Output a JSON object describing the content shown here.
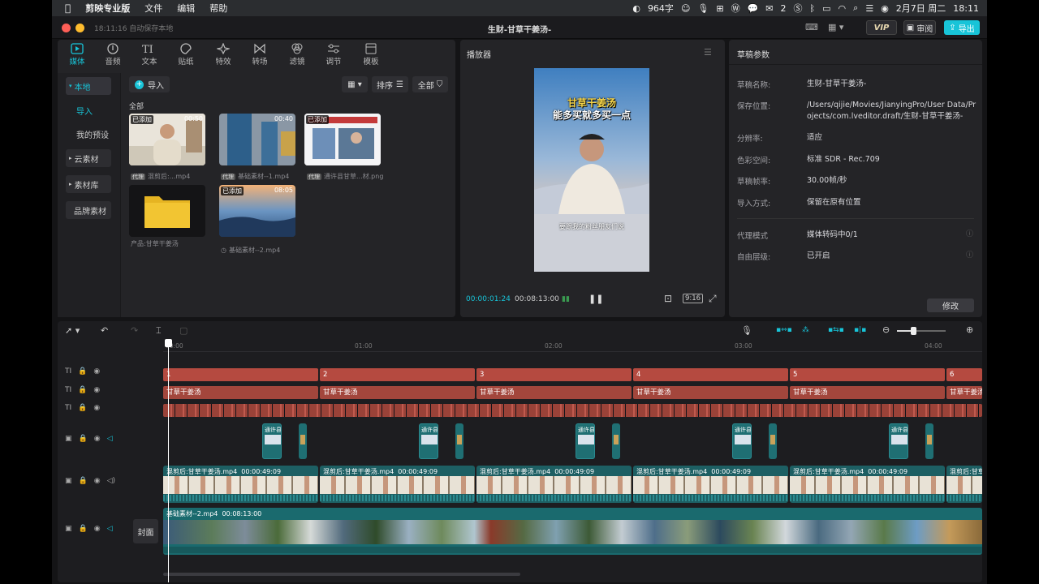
{
  "menubar": {
    "app_name": "剪映专业版",
    "menus": [
      "文件",
      "编辑",
      "帮助"
    ],
    "status_number": "964字",
    "wechat_count": "2",
    "date": "2月7日 周二",
    "time": "18:11"
  },
  "titlebar": {
    "autosave": "18:11:16 自动保存本地",
    "project_title": "生财-甘草干姜汤-",
    "vip_label": "VIP",
    "review_label": "审阅",
    "export_label": "导出"
  },
  "media": {
    "tabs": [
      "媒体",
      "音频",
      "文本",
      "贴纸",
      "特效",
      "转场",
      "滤镜",
      "调节",
      "模板"
    ],
    "sidebar": [
      "本地",
      "导入",
      "我的预设",
      "云素材",
      "素材库",
      "品牌素材"
    ],
    "import_label": "导入",
    "sort_label": "排序",
    "filter_label": "全部",
    "section_label": "全部",
    "items": [
      {
        "badge": "已添加",
        "duration": "00:50",
        "proxy": "代理",
        "caption": "混剪后:...mp4"
      },
      {
        "badge": "",
        "duration": "00:40",
        "proxy": "代理",
        "caption": "基础素材--1.mp4"
      },
      {
        "badge": "已添加",
        "duration": "",
        "proxy": "代理",
        "caption": "通许县甘草...材.png"
      },
      {
        "badge": "",
        "duration": "",
        "proxy": "",
        "caption": "产品:甘草干姜汤"
      },
      {
        "badge": "已添加",
        "duration": "08:05",
        "proxy": "",
        "caption": "基础素材--2.mp4"
      }
    ]
  },
  "player": {
    "title": "播放器",
    "overlay_title_line1": "甘草干姜汤",
    "overlay_title_line2": "能多买就多买一点",
    "subtitle": "要跟我的粉丝朋友们说",
    "current_time": "00:00:01:24",
    "total_time": "00:08:13:00",
    "ratio_label": "9:16"
  },
  "params": {
    "title": "草稿参数",
    "rows": [
      {
        "key": "草稿名称:",
        "value": "生财-甘草干姜汤-"
      },
      {
        "key": "保存位置:",
        "value": "/Users/qijie/Movies/JianyingPro/User Data/Projects/com.lveditor.draft/生财-甘草干姜汤-"
      },
      {
        "key": "分辨率:",
        "value": "适应"
      },
      {
        "key": "色彩空间:",
        "value": "标准 SDR - Rec.709"
      },
      {
        "key": "草稿帧率:",
        "value": "30.00帧/秒"
      },
      {
        "key": "导入方式:",
        "value": "保留在原有位置"
      },
      {
        "key": "代理模式",
        "value": "媒体转码中0/1"
      },
      {
        "key": "自由层级:",
        "value": "已开启"
      }
    ],
    "modify_label": "修改"
  },
  "timeline": {
    "ruler": [
      "00:00",
      "01:00",
      "02:00",
      "03:00",
      "04:00"
    ],
    "title_segments": [
      "1",
      "2",
      "3",
      "4",
      "5",
      "6"
    ],
    "text_segment_label": "甘草干姜汤",
    "overlay_label": "通许县",
    "main_clip_label": "混剪后:甘草干姜汤.mp4",
    "main_clip_duration": "00:00:49:09",
    "bg_clip_label": "基础素材--2.mp4",
    "bg_clip_duration": "00:08:13:00",
    "cover_label": "封面"
  },
  "colors": {
    "accent": "#18c4d8",
    "title_track": "#b54a40",
    "text_track": "#a3463c",
    "video_track": "#1f6f73"
  }
}
